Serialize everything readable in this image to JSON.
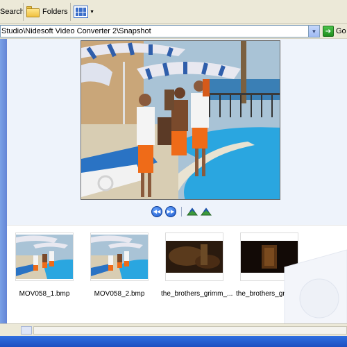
{
  "toolbar": {
    "search_label": "Search",
    "folders_label": "Folders",
    "views_icon": "views-icon"
  },
  "address": {
    "path": "Studio\\Nidesoft Video Converter 2\\Snapshot",
    "go_label": "Go"
  },
  "preview": {
    "buttons": [
      "previous-image",
      "next-image",
      "rotate-clockwise",
      "rotate-counterclockwise"
    ]
  },
  "thumbnails": [
    {
      "label": "MOV058_1.bmp",
      "kind": "pool"
    },
    {
      "label": "MOV058_2.bmp",
      "kind": "pool"
    },
    {
      "label": "the_brothers_grimm_...",
      "kind": "dark-forest"
    },
    {
      "label": "the_brothers_grimm_...",
      "kind": "dark-door"
    }
  ],
  "colors": {
    "window_bg": "#ECE9D8",
    "preview_bg": "#EEF3FB",
    "left_pane": "#6b8fdc",
    "taskbar": "#2458d0"
  }
}
